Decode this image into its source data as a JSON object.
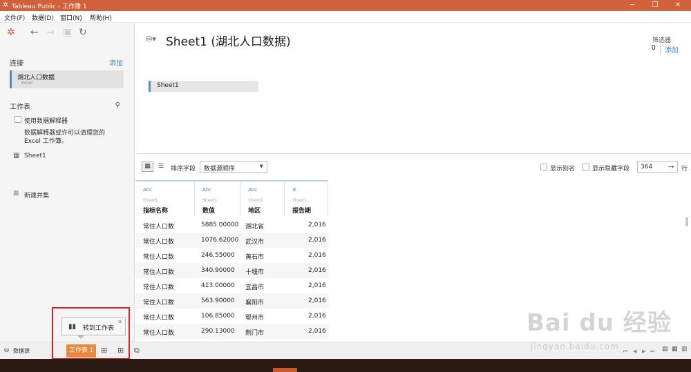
{
  "window": {
    "title": "Tableau Public - 工作簿 1"
  },
  "menu": [
    "文件(F)",
    "数据(D)",
    "窗口(N)",
    "帮助(H)"
  ],
  "left": {
    "connection_title": "连接",
    "connection_add": "添加",
    "connection": {
      "name": "湖北人口数据",
      "type": "Excel"
    },
    "worksheets_title": "工作表",
    "interpreter_label": "使用数据解释器",
    "interpreter_desc_1": "数据解释器或许可以清理您的",
    "interpreter_desc_2": "Excel 工作簿。",
    "sheet_item": "Sheet1",
    "new_union": "新建并集"
  },
  "header": {
    "title": "Sheet1 (湖北人口数据)",
    "filters_label": "筛选器",
    "filters_count": "0",
    "filters_add": "添加",
    "canvas_sheet": "Sheet1"
  },
  "gridbar": {
    "sort_label": "排序字段",
    "sort_value": "数据源顺序",
    "show_alias": "显示别名",
    "show_hidden": "显示隐藏字段",
    "row_count": "364",
    "row_unit": "行"
  },
  "table": {
    "columns": [
      {
        "type": "Abc",
        "source": "Sheet1",
        "name": "指标名称"
      },
      {
        "type": "Abc",
        "source": "Sheet1",
        "name": "数值"
      },
      {
        "type": "Abc",
        "source": "Sheet1",
        "name": "地区"
      },
      {
        "type": "#",
        "source": "Sheet1",
        "name": "报告期"
      }
    ],
    "rows": [
      [
        "常住人口数",
        "5885.00000",
        "湖北省",
        "2,016"
      ],
      [
        "常住人口数",
        "1076.62000",
        "武汉市",
        "2,016"
      ],
      [
        "常住人口数",
        "246.55000",
        "黄石市",
        "2,016"
      ],
      [
        "常住人口数",
        "340.90000",
        "十堰市",
        "2,016"
      ],
      [
        "常住人口数",
        "413.00000",
        "宜昌市",
        "2,016"
      ],
      [
        "常住人口数",
        "563.90000",
        "襄阳市",
        "2,016"
      ],
      [
        "常住人口数",
        "106.85000",
        "鄂州市",
        "2,016"
      ],
      [
        "常住人口数",
        "290.13000",
        "荆门市",
        "2,016"
      ]
    ]
  },
  "tabs": {
    "datasource": "数据源",
    "worksheet": "工作表 1"
  },
  "tooltip": {
    "text": "转到工作表"
  },
  "watermark": {
    "brand": "Bai du 经验",
    "url": "jingyan.baidu.com"
  },
  "colors": {
    "titlebar": "#d1613a",
    "active_tab": "#e8883e",
    "link": "#3d86c2",
    "highlight_box": "#e02020"
  }
}
